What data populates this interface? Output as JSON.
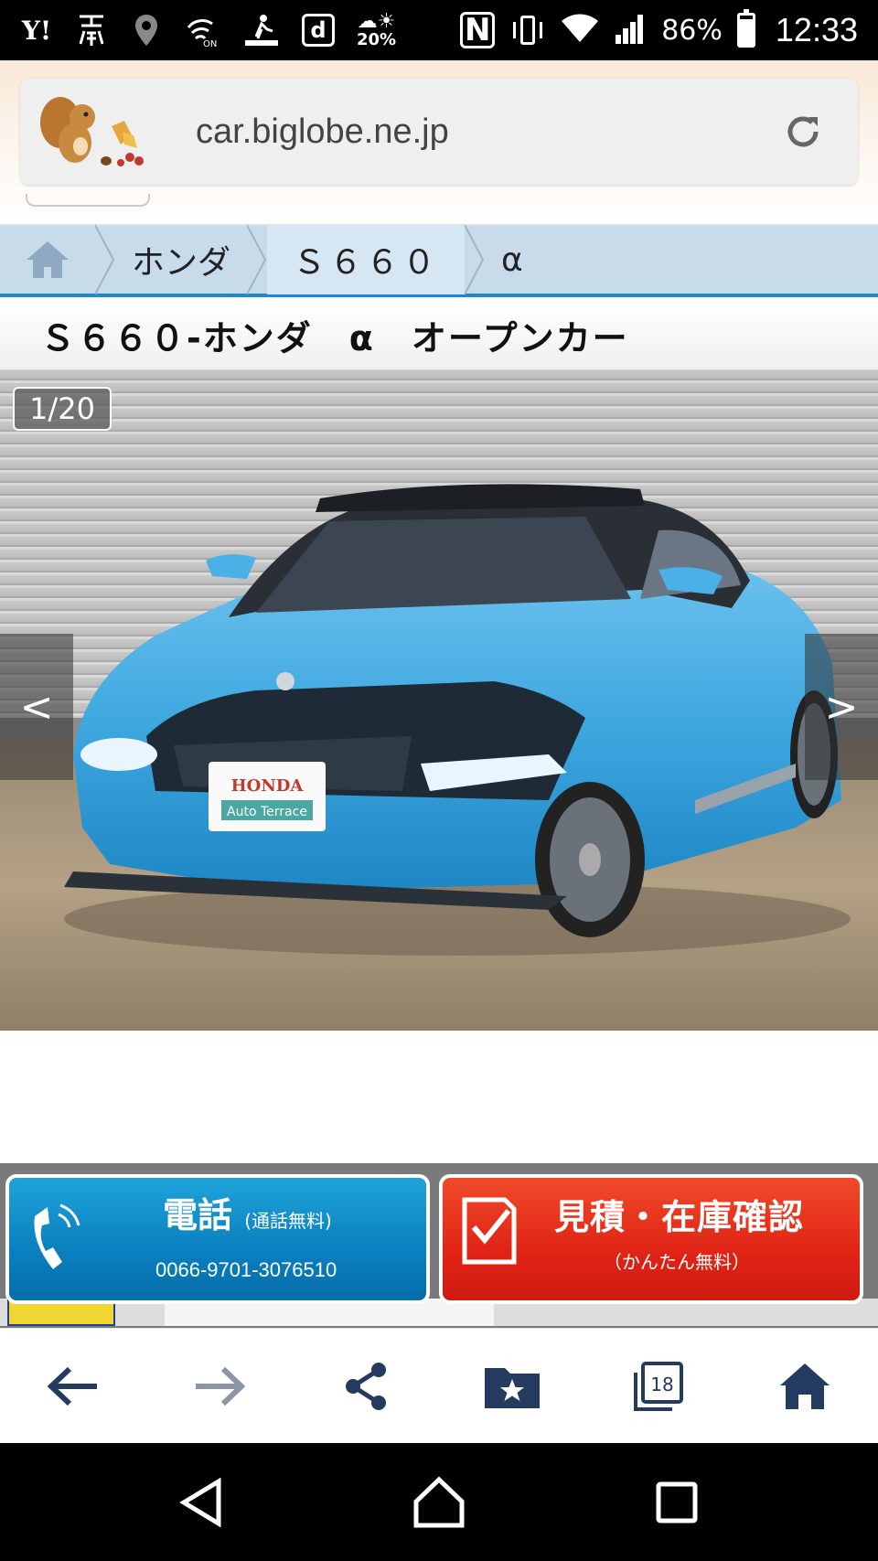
{
  "status_bar": {
    "yahoo_label": "Y!",
    "weather_pct": "20%",
    "nfc_label": "N",
    "d_label": "d",
    "battery_pct": "86%",
    "battery_level": 0.86,
    "time": "12:33",
    "icons": [
      "yahoo-icon",
      "news-icon",
      "location-icon",
      "wireless-on-icon",
      "navigation-icon",
      "d-menu-icon",
      "weather-icon",
      "nfc-icon",
      "vibrate-icon",
      "wifi-icon",
      "signal-icon",
      "battery-icon"
    ]
  },
  "browser": {
    "url": "car.biglobe.ne.jp",
    "reload_icon": "reload-icon"
  },
  "breadcrumb": {
    "home_icon": "home-icon",
    "items": [
      {
        "label": "ホンダ"
      },
      {
        "label": "Ｓ６６０"
      },
      {
        "label": "α"
      }
    ]
  },
  "page": {
    "title": "Ｓ６６０-ホンダ　α　オープンカー"
  },
  "gallery": {
    "counter": "1/20",
    "prev_label": "<",
    "next_label": ">",
    "plate_brand": "HONDA",
    "plate_sub": "Auto Terrace"
  },
  "cta": {
    "call_title": "電話",
    "call_note": "(通話無料)",
    "call_phone": "0066-9701-3076510",
    "quote_title": "見積・在庫確認",
    "quote_note": "（かんたん無料）",
    "colors": {
      "call": "#0a7fbf",
      "quote": "#e02415"
    }
  },
  "toolbar": {
    "tab_count": "18",
    "buttons": [
      "back-icon",
      "forward-icon",
      "share-icon",
      "bookmark-folder-icon",
      "tabs-icon",
      "home-icon"
    ]
  },
  "android_nav": [
    "back-triangle-icon",
    "home-circle-icon",
    "recents-square-icon"
  ]
}
